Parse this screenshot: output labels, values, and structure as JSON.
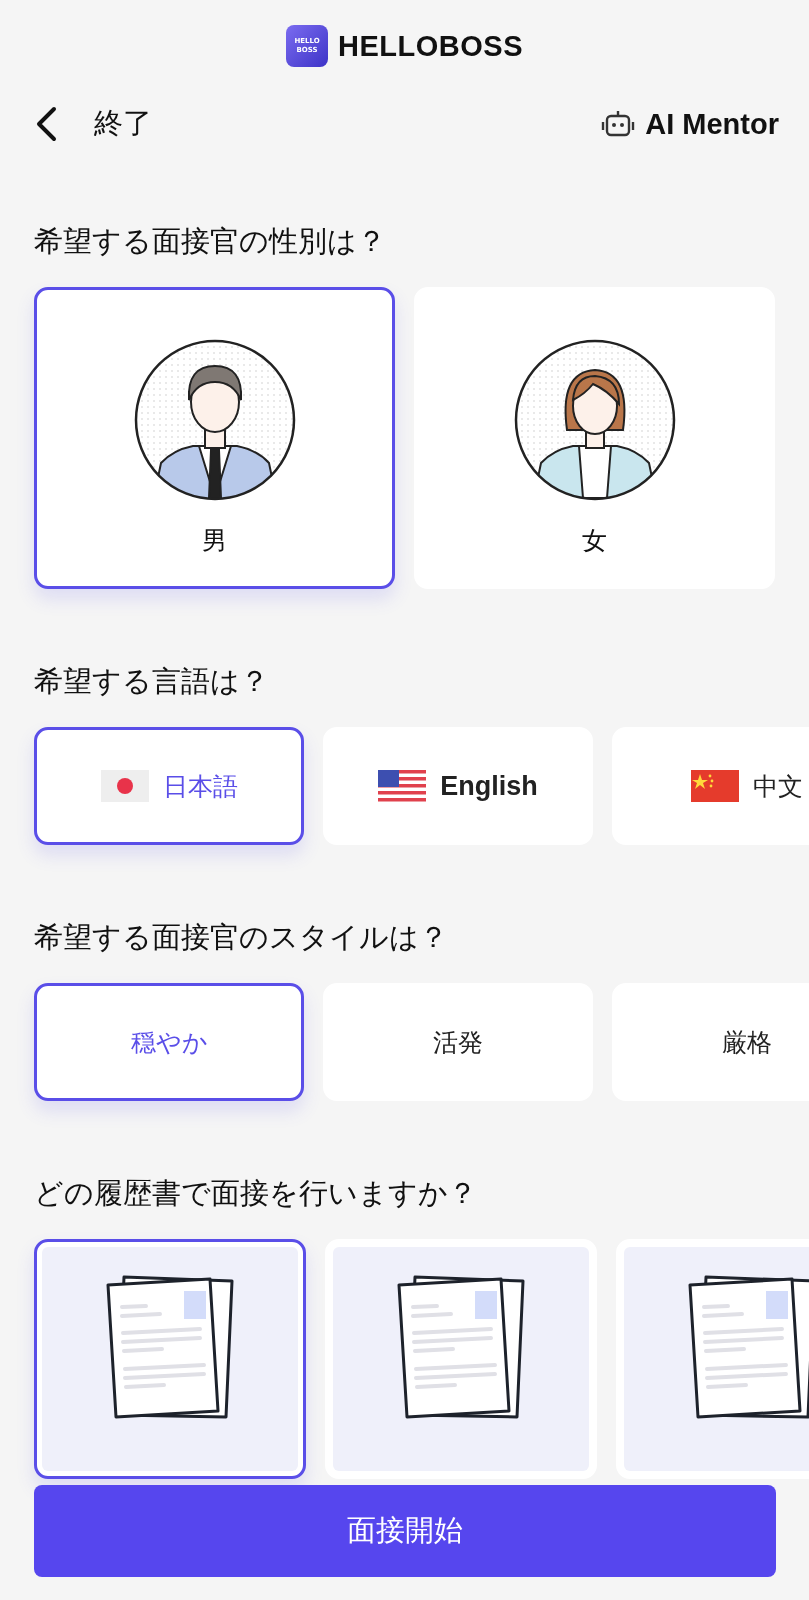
{
  "header": {
    "logo_badge": [
      "HELLO",
      "BOSS"
    ],
    "brand": "HELLOBOSS"
  },
  "nav": {
    "back_label": "終了",
    "mentor_label": "AI Mentor"
  },
  "sections": [
    {
      "kind": "avatar",
      "title": "希望する面接官の性別は？",
      "options": [
        {
          "label": "男",
          "kind": "male",
          "selected": true
        },
        {
          "label": "女",
          "kind": "female",
          "selected": false
        }
      ]
    },
    {
      "kind": "language",
      "title": "希望する言語は？",
      "options": [
        {
          "label": "日本語",
          "kind": "jp",
          "selected": true
        },
        {
          "label": "English",
          "kind": "us",
          "selected": false
        },
        {
          "label": "中文",
          "kind": "cn",
          "selected": false
        }
      ]
    },
    {
      "kind": "text",
      "title": "希望する面接官のスタイルは？",
      "options": [
        {
          "label": "穏やか",
          "selected": true
        },
        {
          "label": "活発",
          "selected": false
        },
        {
          "label": "厳格",
          "selected": false
        }
      ]
    },
    {
      "kind": "resume",
      "title": "どの履歴書で面接を行いますか？",
      "options": [
        {
          "selected": true
        },
        {
          "selected": false
        },
        {
          "selected": false
        }
      ]
    }
  ],
  "start_button": "面接開始"
}
